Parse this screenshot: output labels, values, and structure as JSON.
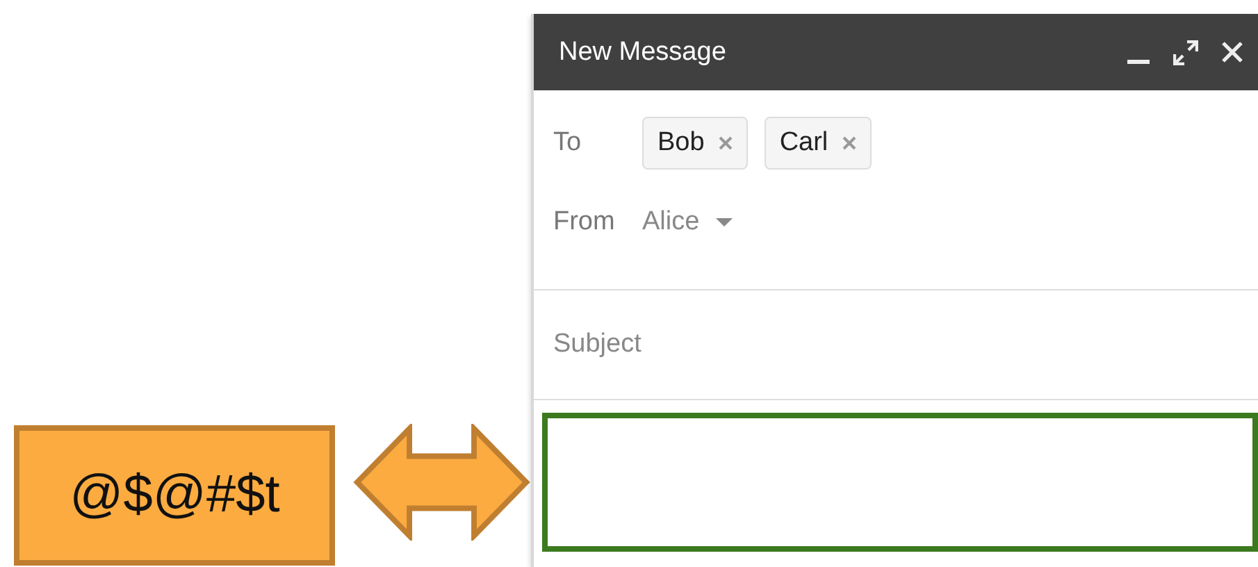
{
  "annotation": {
    "label": "@$@#$t"
  },
  "window": {
    "title": "New Message"
  },
  "to": {
    "label": "To",
    "recipients": [
      {
        "name": "Bob"
      },
      {
        "name": "Carl"
      }
    ]
  },
  "from": {
    "label": "From",
    "value": "Alice"
  },
  "subject": {
    "placeholder": "Subject"
  },
  "body": {
    "highlighted": true
  }
}
